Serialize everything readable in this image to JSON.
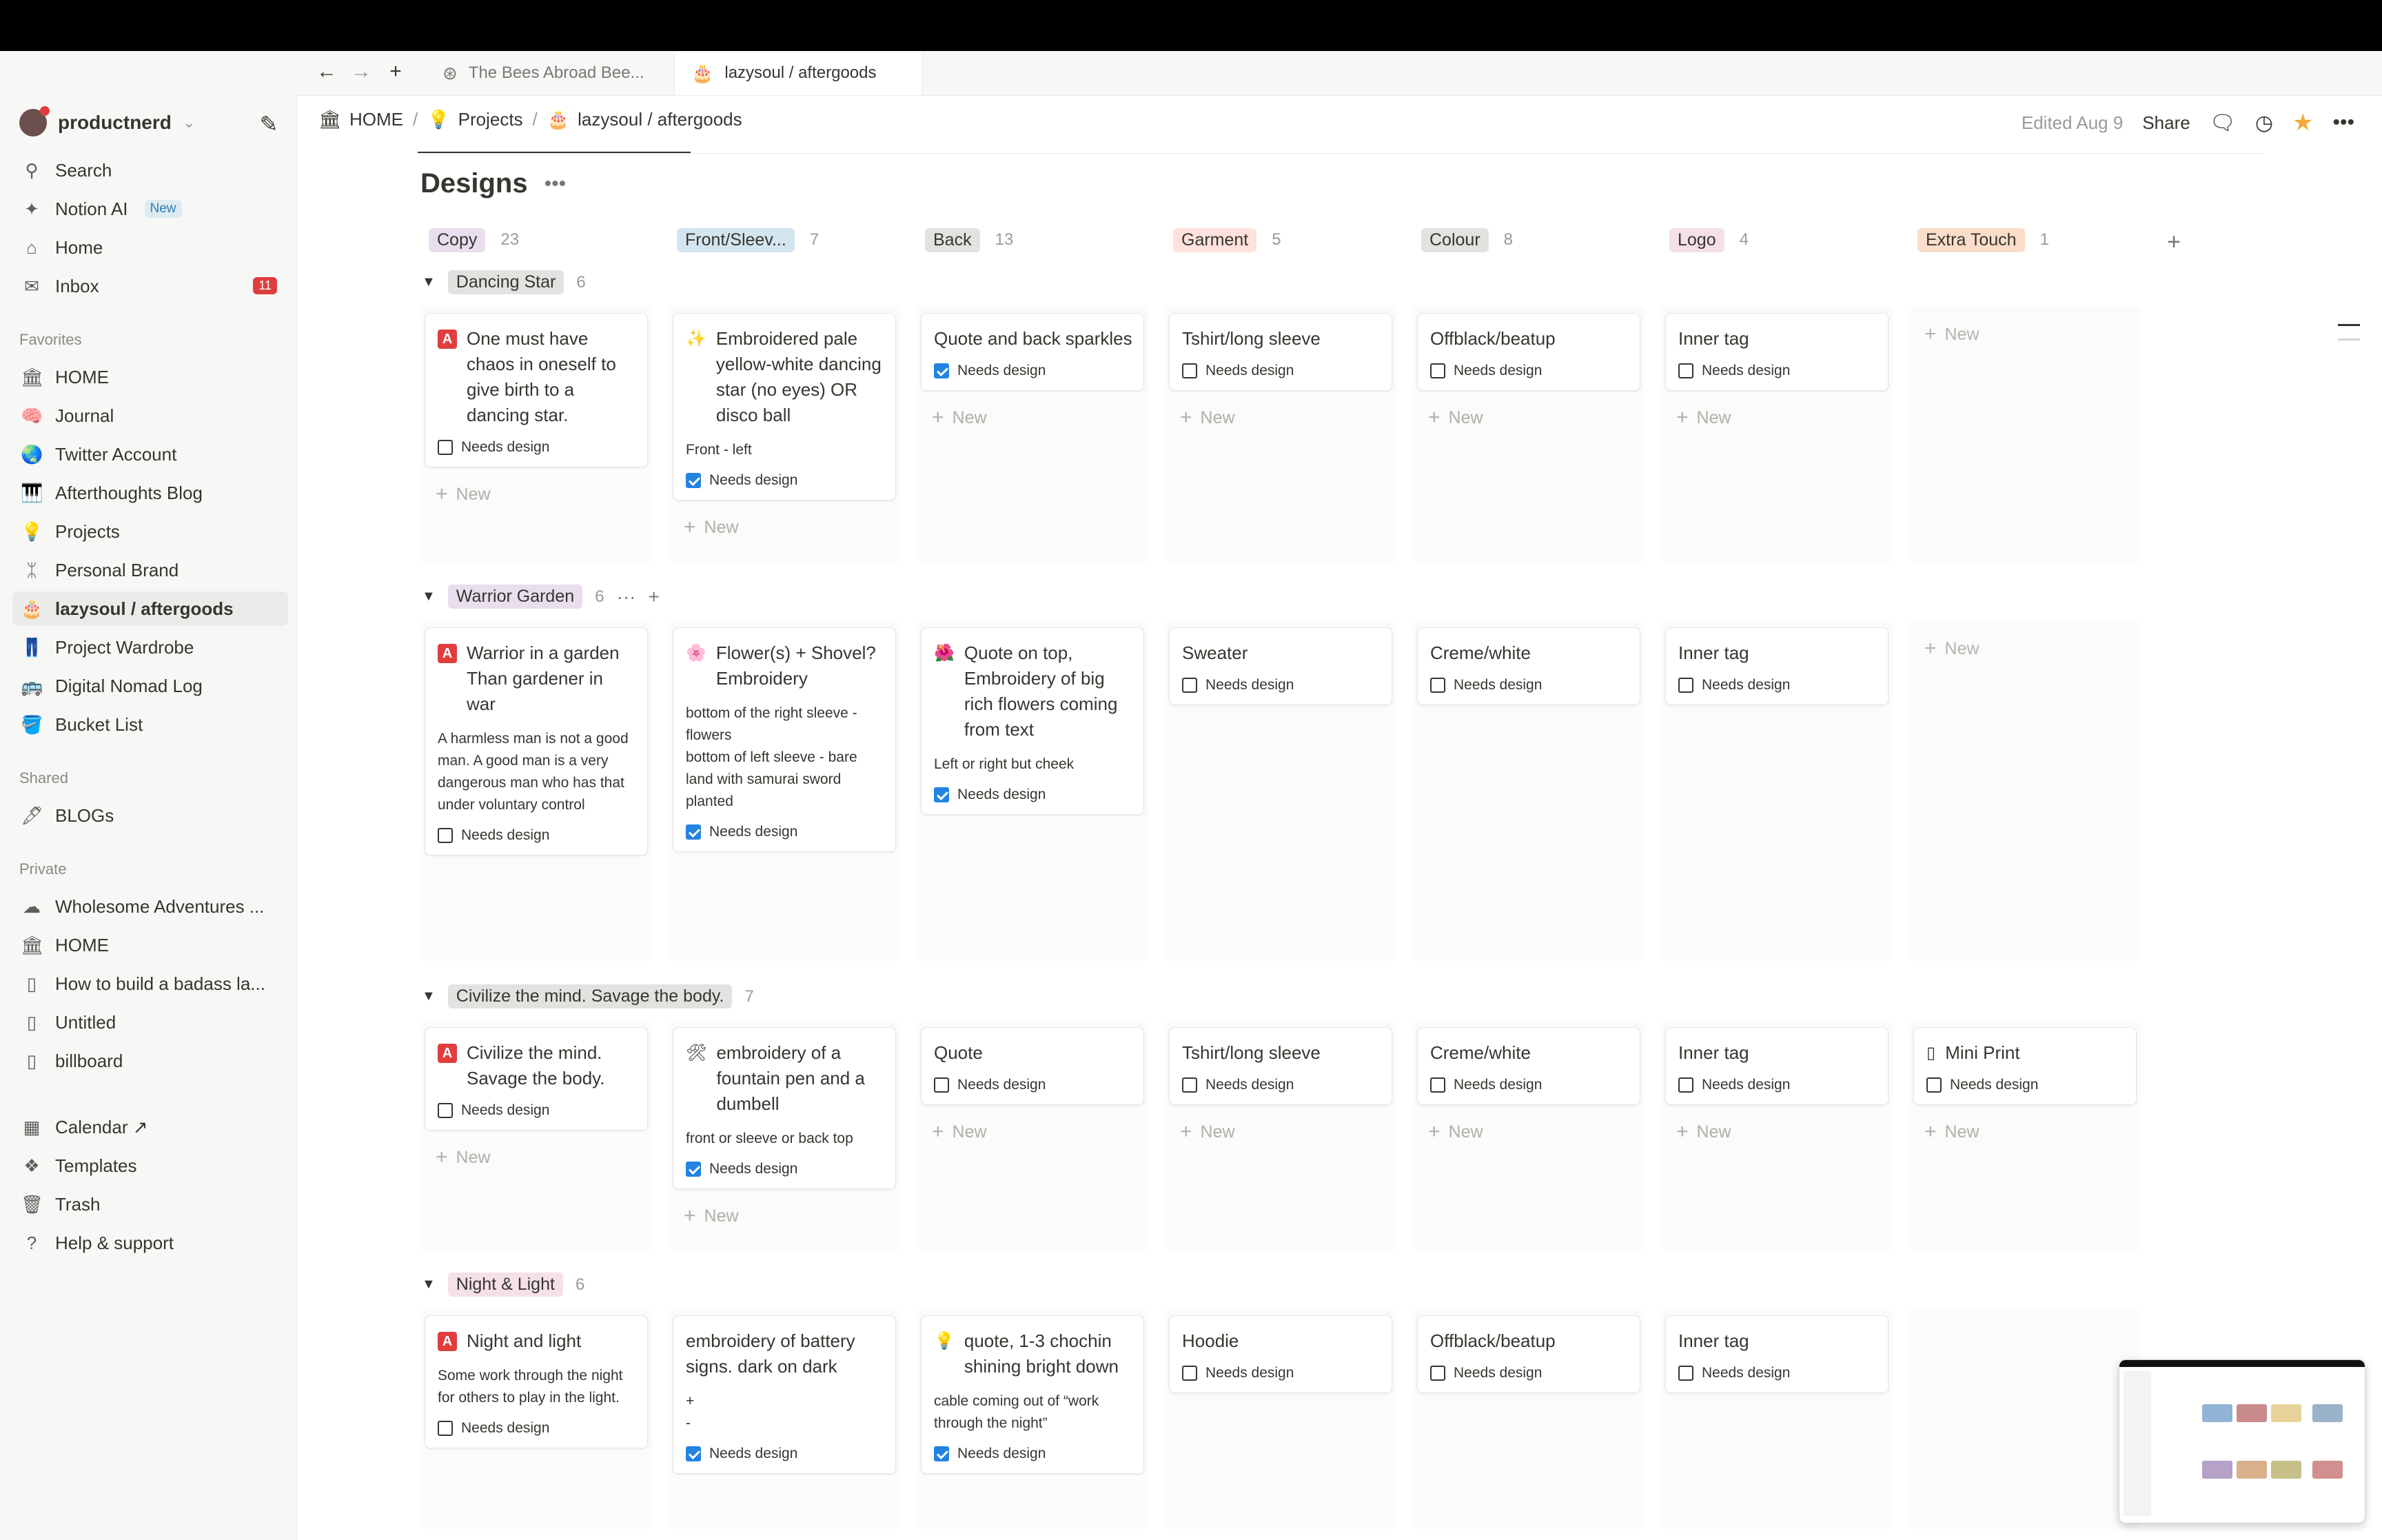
{
  "tabs": [
    {
      "icon": "openai-icon",
      "glyph": "⊛",
      "label": "The Bees Abroad Bee..."
    },
    {
      "icon": "cake-icon",
      "glyph": "🎂",
      "label": "lazysoul / aftergoods"
    }
  ],
  "workspace": {
    "name": "productnerd",
    "chevron": "⌄"
  },
  "sidebar": {
    "top": [
      {
        "icon": "search-icon",
        "glyph": "⚲",
        "label": "Search"
      },
      {
        "icon": "sparkle-icon",
        "glyph": "✦",
        "label": "Notion AI",
        "badge": "New"
      },
      {
        "icon": "home-icon",
        "glyph": "⌂",
        "label": "Home"
      },
      {
        "icon": "inbox-icon",
        "glyph": "✉",
        "label": "Inbox",
        "count": "11"
      }
    ],
    "favorites_label": "Favorites",
    "favorites": [
      {
        "icon": "temple-icon",
        "glyph": "🏛",
        "label": "HOME"
      },
      {
        "icon": "brain-icon",
        "glyph": "🧠",
        "label": "Journal"
      },
      {
        "icon": "globe-icon",
        "glyph": "🌏",
        "label": "Twitter Account"
      },
      {
        "icon": "piano-icon",
        "glyph": "🎹",
        "label": "Afterthoughts Blog"
      },
      {
        "icon": "bulb-icon",
        "glyph": "💡",
        "label": "Projects"
      },
      {
        "icon": "dna-icon",
        "glyph": "ᛯ",
        "label": "Personal Brand"
      },
      {
        "icon": "cake-icon",
        "glyph": "🎂",
        "label": "lazysoul / aftergoods"
      },
      {
        "icon": "jeans-icon",
        "glyph": "👖",
        "label": "Project Wardrobe"
      },
      {
        "icon": "bus-icon",
        "glyph": "🚌",
        "label": "Digital Nomad Log"
      },
      {
        "icon": "bucket-icon",
        "glyph": "🪣",
        "label": "Bucket List"
      }
    ],
    "shared_label": "Shared",
    "shared": [
      {
        "icon": "pen-icon",
        "glyph": "🖋",
        "label": "BLOGs"
      }
    ],
    "private_label": "Private",
    "private": [
      {
        "icon": "cloud-icon",
        "glyph": "☁",
        "label": "Wholesome Adventures ..."
      },
      {
        "icon": "temple-icon",
        "glyph": "🏛",
        "label": "HOME"
      },
      {
        "icon": "page-icon",
        "glyph": "▯",
        "label": "How to build a badass la..."
      },
      {
        "icon": "page-icon",
        "glyph": "▯",
        "label": "Untitled"
      },
      {
        "icon": "page-icon",
        "glyph": "▯",
        "label": "billboard"
      }
    ],
    "bottom": [
      {
        "icon": "calendar-icon",
        "glyph": "▦",
        "label": "Calendar ↗"
      },
      {
        "icon": "templates-icon",
        "glyph": "❖",
        "label": "Templates"
      },
      {
        "icon": "trash-icon",
        "glyph": "🗑",
        "label": "Trash"
      },
      {
        "icon": "help-icon",
        "glyph": "?",
        "label": "Help & support"
      }
    ]
  },
  "breadcrumb": [
    {
      "icon": "temple-icon",
      "glyph": "🏛",
      "label": "HOME"
    },
    {
      "icon": "bulb-icon",
      "glyph": "💡",
      "label": "Projects"
    },
    {
      "icon": "cake-icon",
      "glyph": "🎂",
      "label": "lazysoul / aftergoods"
    }
  ],
  "header": {
    "edited": "Edited Aug 9",
    "share": "Share"
  },
  "page_title": "Designs",
  "columns": [
    {
      "label": "Copy",
      "count": "23",
      "color": "#e8deee"
    },
    {
      "label": "Front/Sleev...",
      "count": "7",
      "color": "#d3e5ef"
    },
    {
      "label": "Back",
      "count": "13",
      "color": "#e3e2e0"
    },
    {
      "label": "Garment",
      "count": "5",
      "color": "#ffe2dd"
    },
    {
      "label": "Colour",
      "count": "8",
      "color": "#e3e2e0"
    },
    {
      "label": "Logo",
      "count": "4",
      "color": "#f5e0e9"
    },
    {
      "label": "Extra Touch",
      "count": "1",
      "color": "#fadec9"
    }
  ],
  "new_label": "New",
  "needs_design_label": "Needs design",
  "groups": [
    {
      "name": "Dancing Star",
      "count": "6",
      "color": "#e3e2e0",
      "cards": [
        {
          "icon": "red-a-icon",
          "title": "One must have chaos in oneself to give birth to a dancing star.",
          "body": "",
          "checked": false
        },
        {
          "icon": "sparkles-icon",
          "glyph": "✨",
          "title": "Embroidered pale yellow-white dancing star (no eyes) OR disco ball",
          "body": "Front - left",
          "checked": true
        },
        {
          "title": "Quote and back sparkles",
          "body": "",
          "checked": true
        },
        {
          "title": "Tshirt/long sleeve",
          "body": "",
          "checked": false
        },
        {
          "title": "Offblack/beatup",
          "body": "",
          "checked": false
        },
        {
          "title": "Inner tag",
          "body": "",
          "checked": false
        },
        null
      ]
    },
    {
      "name": "Warrior Garden",
      "count": "6",
      "color": "#e8deee",
      "cards": [
        {
          "icon": "red-a-icon",
          "title": "Warrior in a garden Than gardener in war",
          "body": "A harmless man is not a good man. A good man is a very dangerous man who has that under voluntary control",
          "checked": false
        },
        {
          "icon": "flower-icon",
          "glyph": "🌸",
          "title": "Flower(s) + Shovel? Embroidery",
          "body": "bottom of the right sleeve - flowers\nbottom of left sleeve - bare land with samurai sword planted",
          "checked": true
        },
        {
          "icon": "hibiscus-icon",
          "glyph": "🌺",
          "title": "Quote on top, Embroidery of big rich flowers coming from text",
          "body": "Left or right but cheek",
          "checked": true
        },
        {
          "title": "Sweater",
          "body": "",
          "checked": false
        },
        {
          "title": "Creme/white",
          "body": "",
          "checked": false
        },
        {
          "title": "Inner tag",
          "body": "",
          "checked": false
        },
        null
      ]
    },
    {
      "name": "Civilize the mind. Savage the body.",
      "count": "7",
      "color": "#e3e2e0",
      "cards": [
        {
          "icon": "red-a-icon",
          "title": "Civilize the mind. Savage the body.",
          "body": "",
          "checked": false
        },
        {
          "icon": "tools-icon",
          "glyph": "🛠",
          "title": "embroidery of a fountain pen and a dumbell",
          "body": "front or sleeve or back top",
          "checked": true
        },
        {
          "title": "Quote",
          "body": "",
          "checked": false
        },
        {
          "title": "Tshirt/long sleeve",
          "body": "",
          "checked": false
        },
        {
          "title": "Creme/white",
          "body": "",
          "checked": false
        },
        {
          "title": "Inner tag",
          "body": "",
          "checked": false
        },
        {
          "icon": "page-icon",
          "glyph": "▯",
          "title": "Mini Print",
          "body": "",
          "checked": false
        }
      ]
    },
    {
      "name": "Night & Light",
      "count": "6",
      "color": "#f5e0e9",
      "cards": [
        {
          "icon": "red-a-icon",
          "title": "Night and light",
          "body": "Some work through the night\nfor others to play in the light.",
          "checked": false
        },
        {
          "title": "embroidery of battery signs. dark on dark",
          "body": "+\n-",
          "checked": true
        },
        {
          "icon": "bulb-icon",
          "glyph": "💡",
          "title": "quote, 1-3 chochin shining bright down",
          "body": "cable coming out of “work through the night”",
          "checked": true
        },
        {
          "title": "Hoodie",
          "body": "",
          "checked": false
        },
        {
          "title": "Offblack/beatup",
          "body": "",
          "checked": false
        },
        {
          "title": "Inner tag",
          "body": "",
          "checked": false
        },
        null
      ]
    }
  ]
}
